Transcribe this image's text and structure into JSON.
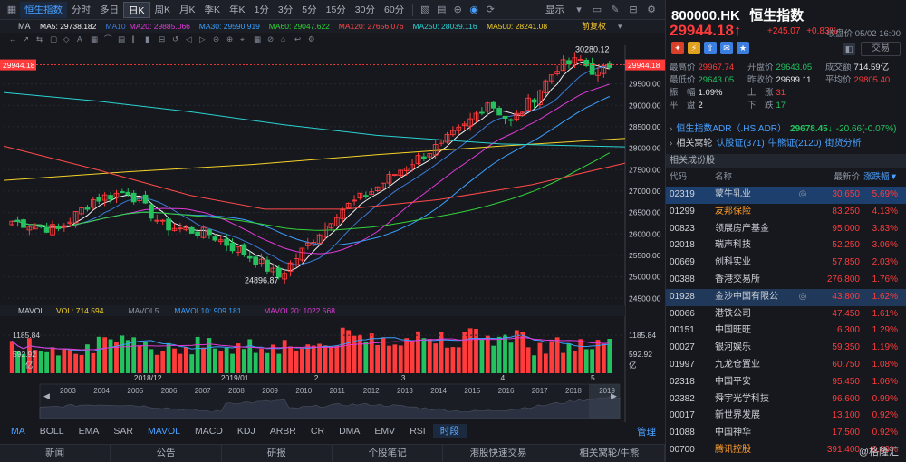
{
  "toolbar": {
    "items": [
      {
        "label": "恒生指数",
        "active": true
      },
      {
        "label": "分时"
      },
      {
        "label": "多日"
      },
      {
        "label": "日K",
        "active": true
      },
      {
        "label": "周K"
      },
      {
        "label": "月K"
      },
      {
        "label": "季K"
      },
      {
        "label": "年K"
      },
      {
        "label": "1分"
      },
      {
        "label": "3分"
      },
      {
        "label": "5分"
      },
      {
        "label": "15分"
      },
      {
        "label": "30分"
      },
      {
        "label": "60分"
      }
    ],
    "display_label": "显示"
  },
  "ma_bar": {
    "label": "MA",
    "items": [
      {
        "text": "MA5: 29738.182",
        "color": "#f2f2f2"
      },
      {
        "text": "MA10",
        "color": "#3b7bd8"
      },
      {
        "text": "MA20: 29885.066",
        "color": "#e03ad8"
      },
      {
        "text": "MA30: 29590.919",
        "color": "#3aa0ff"
      },
      {
        "text": "MA60: 29047.622",
        "color": "#34d33a"
      },
      {
        "text": "MA120: 27656.076",
        "color": "#ff4a4a"
      },
      {
        "text": "MA250: 28039.116",
        "color": "#2ad3d3"
      },
      {
        "text": "MA500: 28241.08",
        "color": "#f5d32a"
      }
    ],
    "adjust_label": "前复权"
  },
  "chart_labels": {
    "current_price": "29944.18",
    "high_annotation": "30280.12",
    "low_annotation": "24896.87",
    "price_ticks": [
      "29500.00",
      "29000.00",
      "28500.00",
      "28000.00",
      "27500.00",
      "27000.00",
      "26500.00",
      "26000.00",
      "25500.00",
      "25000.00",
      "24500.00"
    ],
    "vol_title": "MAVOL",
    "vol_items": [
      {
        "text": "VOL: 714.594",
        "color": "#f5d32a"
      },
      {
        "text": "MAVOL5",
        "color": "#8f96a3"
      },
      {
        "text": "MAVOL10: 909.181",
        "color": "#3aa0ff"
      },
      {
        "text": "MAVOL20: 1022.568",
        "color": "#e03ad8"
      }
    ],
    "vol_ticks": [
      "1185.84",
      "592.92",
      "亿"
    ],
    "date_labels": [
      "2018/12",
      "2019/01",
      "2",
      "3",
      "4",
      "5"
    ],
    "years": [
      "2003",
      "2004",
      "2005",
      "2006",
      "2007",
      "2008",
      "2009",
      "2010",
      "2011",
      "2012",
      "2013",
      "2014",
      "2015",
      "2016",
      "2017",
      "2018",
      "2019"
    ]
  },
  "indicator_tabs": [
    "MA",
    "BOLL",
    "EMA",
    "SAR",
    "MAVOL",
    "MACD",
    "KDJ",
    "ARBR",
    "CR",
    "DMA",
    "EMV",
    "RSI",
    "时段"
  ],
  "manage_label": "管理",
  "bottom_tabs": [
    "新闻",
    "公告",
    "研报",
    "个股笔记",
    "港股快速交易",
    "相关窝轮/牛熊"
  ],
  "quote": {
    "code": "800000.HK",
    "name": "恒生指数",
    "price": "29944.18",
    "arrow": "↑",
    "change": "+245.07",
    "change_pct": "+0.83%",
    "close_label": "收盘价 05/02 16:00",
    "trade_label": "交易",
    "stats": [
      [
        {
          "label": "最高价",
          "value": "29967.74",
          "cls": "red"
        },
        {
          "label": "开盘价",
          "value": "29643.05",
          "cls": "green"
        },
        {
          "label": "成交额",
          "value": "714.59亿",
          "cls": "white"
        }
      ],
      [
        {
          "label": "最低价",
          "value": "29643.05",
          "cls": "green"
        },
        {
          "label": "昨收价",
          "value": "29699.11",
          "cls": "white"
        },
        {
          "label": "平均价",
          "value": "29805.40",
          "cls": "red"
        }
      ],
      [
        {
          "label": "振　幅",
          "value": "1.09%",
          "cls": "white"
        },
        {
          "label": "上　涨",
          "value": "31",
          "cls": "red"
        },
        {
          "label": "",
          "value": "",
          "cls": "white"
        }
      ],
      [
        {
          "label": "平　盘",
          "value": "2",
          "cls": "white"
        },
        {
          "label": "下　跌",
          "value": "17",
          "cls": "green"
        },
        {
          "label": "",
          "value": "",
          "cls": "white"
        }
      ]
    ],
    "adr_label": "恒生指数ADR（.HSIADR）",
    "adr_value": "29678.45↓",
    "adr_change": "-20.66(-0.07%)",
    "warrant_label": "相关窝轮",
    "warrant_call": "认股证(371)",
    "warrant_bull": "牛熊证(2120)",
    "warrant_street": "街货分析",
    "section_title": "相关成份股",
    "table_head": {
      "code": "代码",
      "name": "名称",
      "last": "最新价",
      "pct": "涨跌幅▼"
    },
    "rows": [
      {
        "code": "02319",
        "name": "蒙牛乳业",
        "last": "30.650",
        "pct": "5.69%",
        "hl": "hl",
        "icon": "◎",
        "name_cls": "white"
      },
      {
        "code": "01299",
        "name": "友邦保险",
        "last": "83.250",
        "pct": "4.13%",
        "name_cls": "orange"
      },
      {
        "code": "00823",
        "name": "领展房产基金",
        "last": "95.000",
        "pct": "3.83%"
      },
      {
        "code": "02018",
        "name": "瑞声科技",
        "last": "52.250",
        "pct": "3.06%"
      },
      {
        "code": "00669",
        "name": "创科实业",
        "last": "57.850",
        "pct": "2.03%"
      },
      {
        "code": "00388",
        "name": "香港交易所",
        "last": "276.800",
        "pct": "1.76%"
      },
      {
        "code": "01928",
        "name": "金沙中国有限公",
        "last": "43.800",
        "pct": "1.62%",
        "hl": "hl2",
        "icon": "◎"
      },
      {
        "code": "00066",
        "name": "港铁公司",
        "last": "47.450",
        "pct": "1.61%"
      },
      {
        "code": "00151",
        "name": "中国旺旺",
        "last": "6.300",
        "pct": "1.29%"
      },
      {
        "code": "00027",
        "name": "银河娱乐",
        "last": "59.350",
        "pct": "1.19%"
      },
      {
        "code": "01997",
        "name": "九龙仓置业",
        "last": "60.750",
        "pct": "1.08%"
      },
      {
        "code": "02318",
        "name": "中国平安",
        "last": "95.450",
        "pct": "1.06%"
      },
      {
        "code": "02382",
        "name": "舜宇光学科技",
        "last": "96.600",
        "pct": "0.99%"
      },
      {
        "code": "00017",
        "name": "新世界发展",
        "last": "13.100",
        "pct": "0.92%"
      },
      {
        "code": "01088",
        "name": "中国神华",
        "last": "17.500",
        "pct": "0.92%"
      },
      {
        "code": "00700",
        "name": "腾讯控股",
        "last": "391.400",
        "pct": "0.89%",
        "name_cls": "orange"
      }
    ],
    "watermark": "@格隆汇"
  },
  "colors": {
    "up": "#ff3b3b",
    "down": "#23c25e",
    "accent": "#4aa0ff",
    "bg": "#16181d"
  }
}
